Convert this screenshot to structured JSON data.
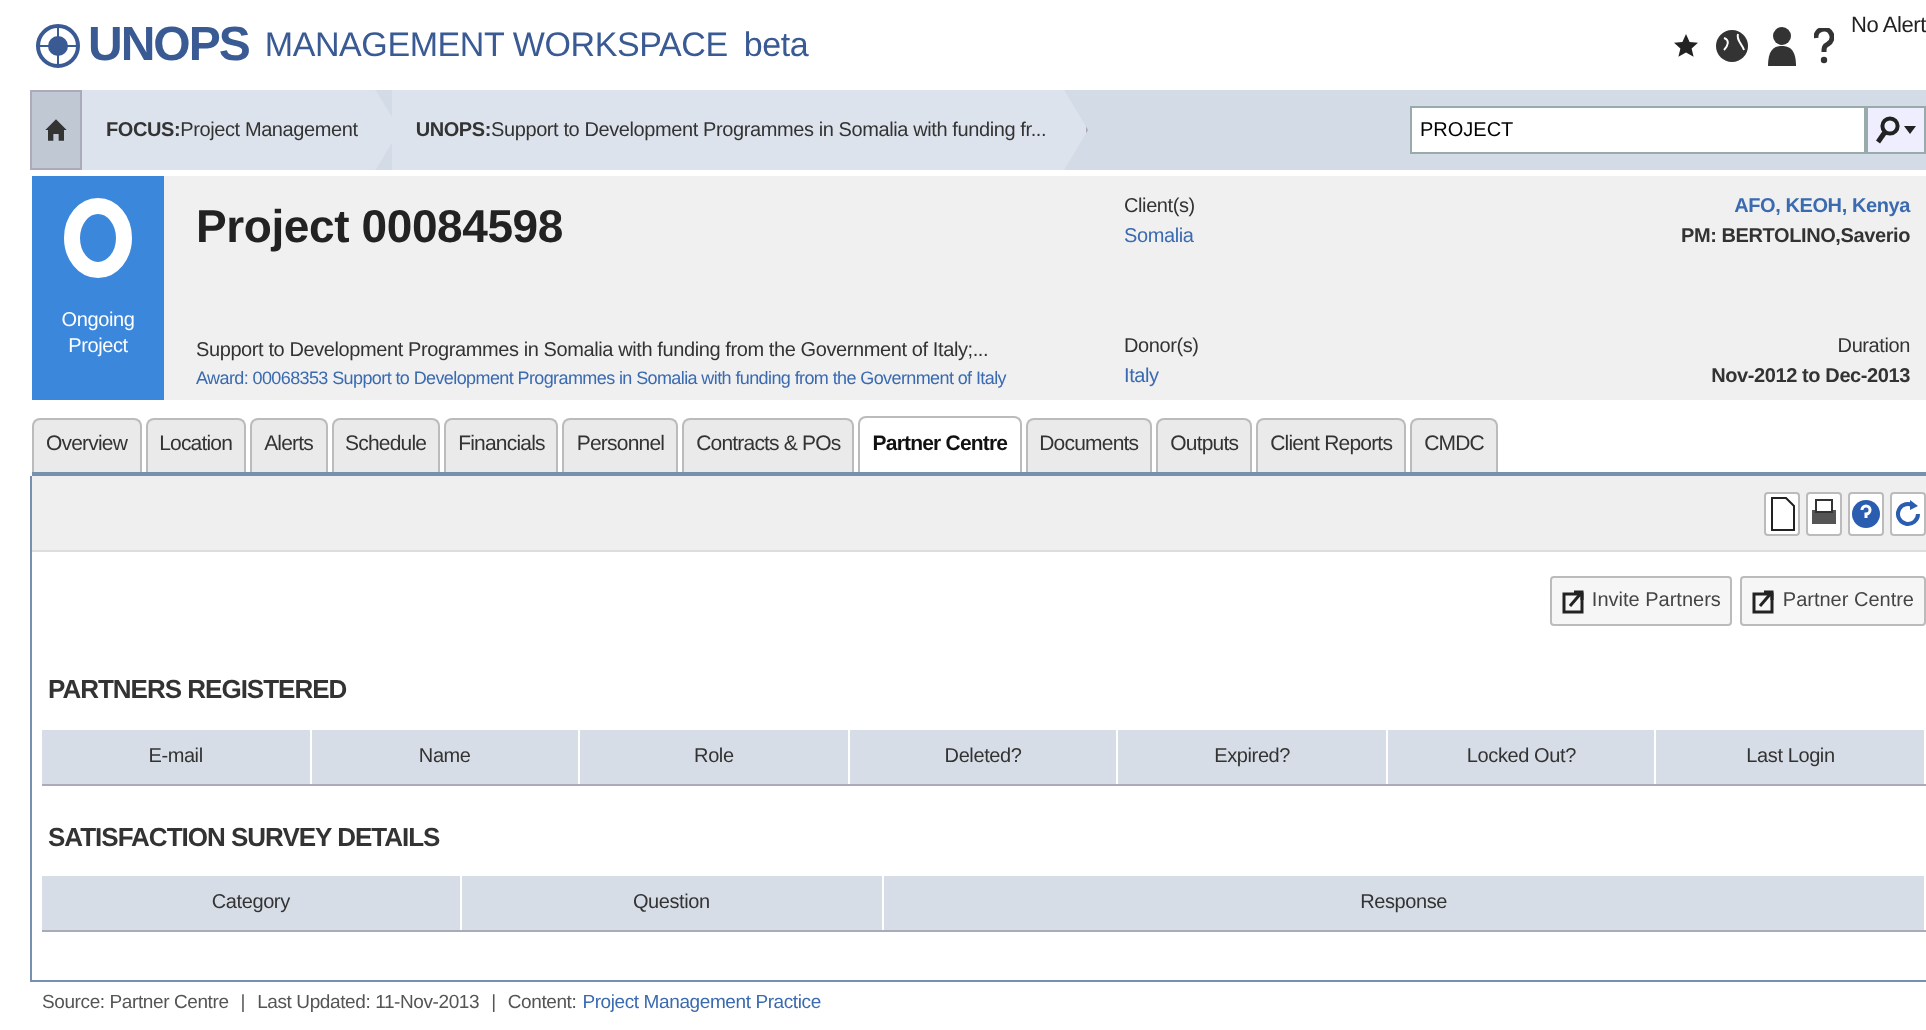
{
  "header": {
    "logo": "UNOPS",
    "app_title": "MANAGEMENT WORKSPACE",
    "badge": "beta",
    "alerts": "No Alert"
  },
  "breadcrumbs": [
    {
      "prefix": "FOCUS:",
      "label": "Project Management"
    },
    {
      "prefix": "UNOPS:",
      "label": "Support to Development Programmes in Somalia with funding fr..."
    }
  ],
  "search": {
    "value": "PROJECT"
  },
  "project": {
    "status": "Ongoing Project",
    "title": "Project 00084598",
    "description": "Support to Development Programmes in Somalia with funding from the Government of Italy;...",
    "award": "Award: 00068353 Support to Development Programmes in Somalia with funding from the Government of Italy",
    "client_label": "Client(s)",
    "client": "Somalia",
    "donor_label": "Donor(s)",
    "donor": "Italy",
    "office": "AFO, KEOH, Kenya",
    "pm": "PM: BERTOLINO,Saverio",
    "duration_label": "Duration",
    "duration": "Nov-2012 to Dec-2013"
  },
  "tabs": [
    {
      "label": "Overview",
      "selected": false
    },
    {
      "label": "Location",
      "selected": false
    },
    {
      "label": "Alerts",
      "selected": false
    },
    {
      "label": "Schedule",
      "selected": false
    },
    {
      "label": "Financials",
      "selected": false
    },
    {
      "label": "Personnel",
      "selected": false
    },
    {
      "label": "Contracts & POs",
      "selected": false
    },
    {
      "label": "Partner Centre",
      "selected": true
    },
    {
      "label": "Documents",
      "selected": false
    },
    {
      "label": "Outputs",
      "selected": false
    },
    {
      "label": "Client Reports",
      "selected": false
    },
    {
      "label": "CMDC",
      "selected": false
    }
  ],
  "buttons": [
    "Invite Partners",
    "Partner Centre"
  ],
  "sections": [
    {
      "heading": "PARTNERS REGISTERED",
      "columns": [
        "E-mail",
        "Name",
        "Role",
        "Deleted?",
        "Expired?",
        "Locked Out?",
        "Last Login"
      ]
    },
    {
      "heading": "SATISFACTION SURVEY DETAILS",
      "columns": [
        "Category",
        "Question",
        "Response"
      ]
    }
  ],
  "footer": {
    "items": [
      "Source: Partner Centre",
      "Last Updated: 11-Nov-2013"
    ],
    "separator": "|",
    "content_label": "Content:",
    "content_link": "Project Management Practice"
  }
}
